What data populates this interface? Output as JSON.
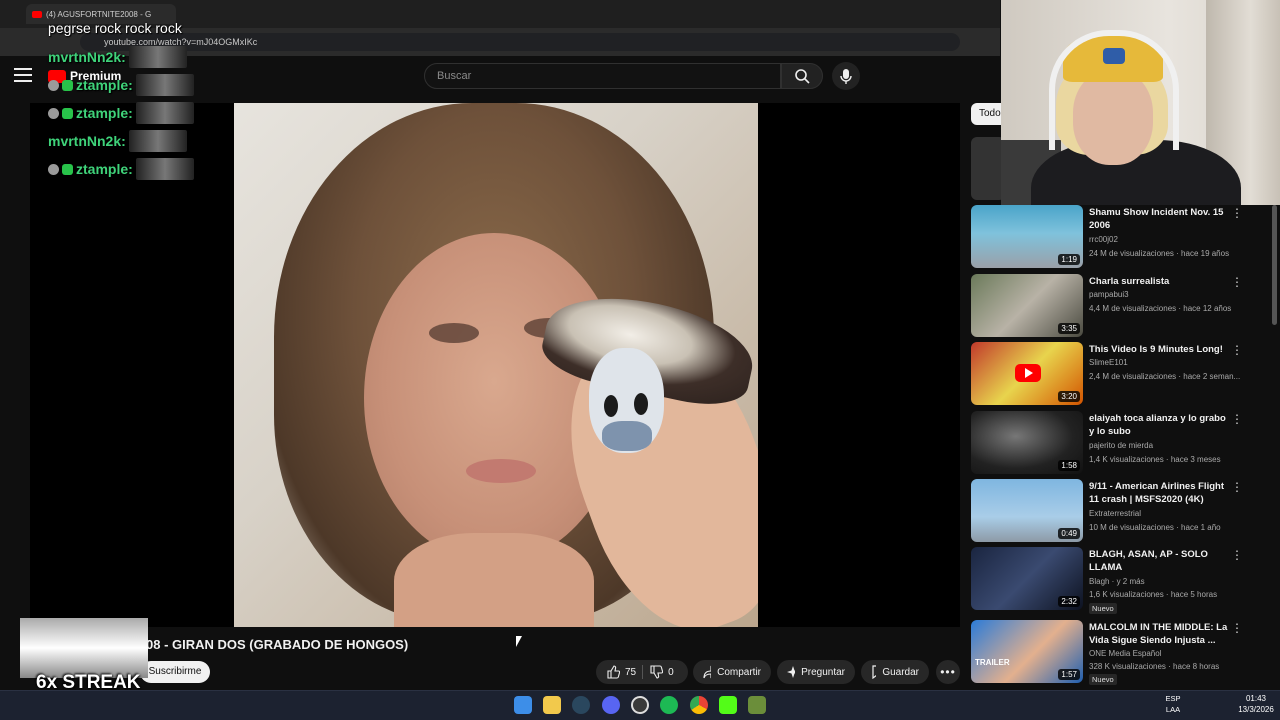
{
  "browser": {
    "tab_title": "(4) AGUSFORTNITE2008 - G",
    "url": "youtube.com/watch?v=mJ04OGMxIKc"
  },
  "youtube": {
    "search_placeholder": "Buscar",
    "logo_label": "Premium",
    "video_title": "08 - GIRAN DOS (GRABADO DE HONGOS)",
    "subscribe_label": "Suscribirme",
    "likes": "75",
    "dislikes": "0",
    "share_label": "Compartir",
    "ask_label": "Preguntar",
    "save_label": "Guardar",
    "filter_chip": "Todo",
    "colors": {
      "accent": "#ff0000",
      "background": "#0f0f0f"
    }
  },
  "recommendations": [
    {
      "title": "Shamu Show Incident Nov. 15 2006",
      "channel": "rrc00j02",
      "meta": "24 M de visualizaciones · hace 19 años",
      "duration": "1:19"
    },
    {
      "title": "Charla surrealista",
      "channel": "pampabui3",
      "meta": "4,4 M de visualizaciones · hace 12 años",
      "duration": "3:35"
    },
    {
      "title": "This Video Is 9 Minutes Long!",
      "channel": "SlimeE101",
      "meta": "2,4 M de visualizaciones · hace 2 seman...",
      "duration": "3:20"
    },
    {
      "title": "elaiyah toca alianza y lo grabo y lo subo",
      "channel": "pajerito de mierda",
      "meta": "1,4 K visualizaciones · hace 3 meses",
      "duration": "1:58"
    },
    {
      "title": "9/11 - American Airlines Flight 11 crash | MSFS2020 (4K)",
      "channel": "Extraterrestrial",
      "meta": "10 M de visualizaciones · hace 1 año",
      "duration": "0:49"
    },
    {
      "title": "BLAGH, ASAN, AP - SOLO LLAMA",
      "channel": "Blagh · y 2 más",
      "meta": "1,6 K visualizaciones · hace 5 horas",
      "duration": "2:32",
      "badge": "Nuevo"
    },
    {
      "title": "MALCOLM IN THE MIDDLE: La Vida Sigue Siendo Injusta ...",
      "channel": "ONE Media Español",
      "meta": "328 K visualizaciones · hace 8 horas",
      "duration": "1:57",
      "badge": "Nuevo",
      "thumb_label": "TRAILER"
    }
  ],
  "chat": {
    "top_message": "pegrse rock rock rock",
    "lines": [
      {
        "user": "mvrtnNn2k:",
        "color": "#3fd37a"
      },
      {
        "user": "ztample:",
        "color": "#3fd37a"
      },
      {
        "user": "ztample:",
        "color": "#3fd37a"
      },
      {
        "user": "mvrtnNn2k:",
        "color": "#3fd37a"
      },
      {
        "user": "ztample:",
        "color": "#3fd37a"
      }
    ]
  },
  "overlay": {
    "streak": "6x STREAK"
  },
  "taskbar": {
    "lang_line1": "ESP",
    "lang_line2": "LAA",
    "time": "01:43",
    "date": "13/3/2026",
    "icons": [
      "windows-start-icon",
      "file-explorer-icon",
      "steam-icon",
      "discord-icon",
      "obs-icon",
      "spotify-icon",
      "chrome-icon",
      "kick-icon",
      "minecraft-icon"
    ]
  }
}
